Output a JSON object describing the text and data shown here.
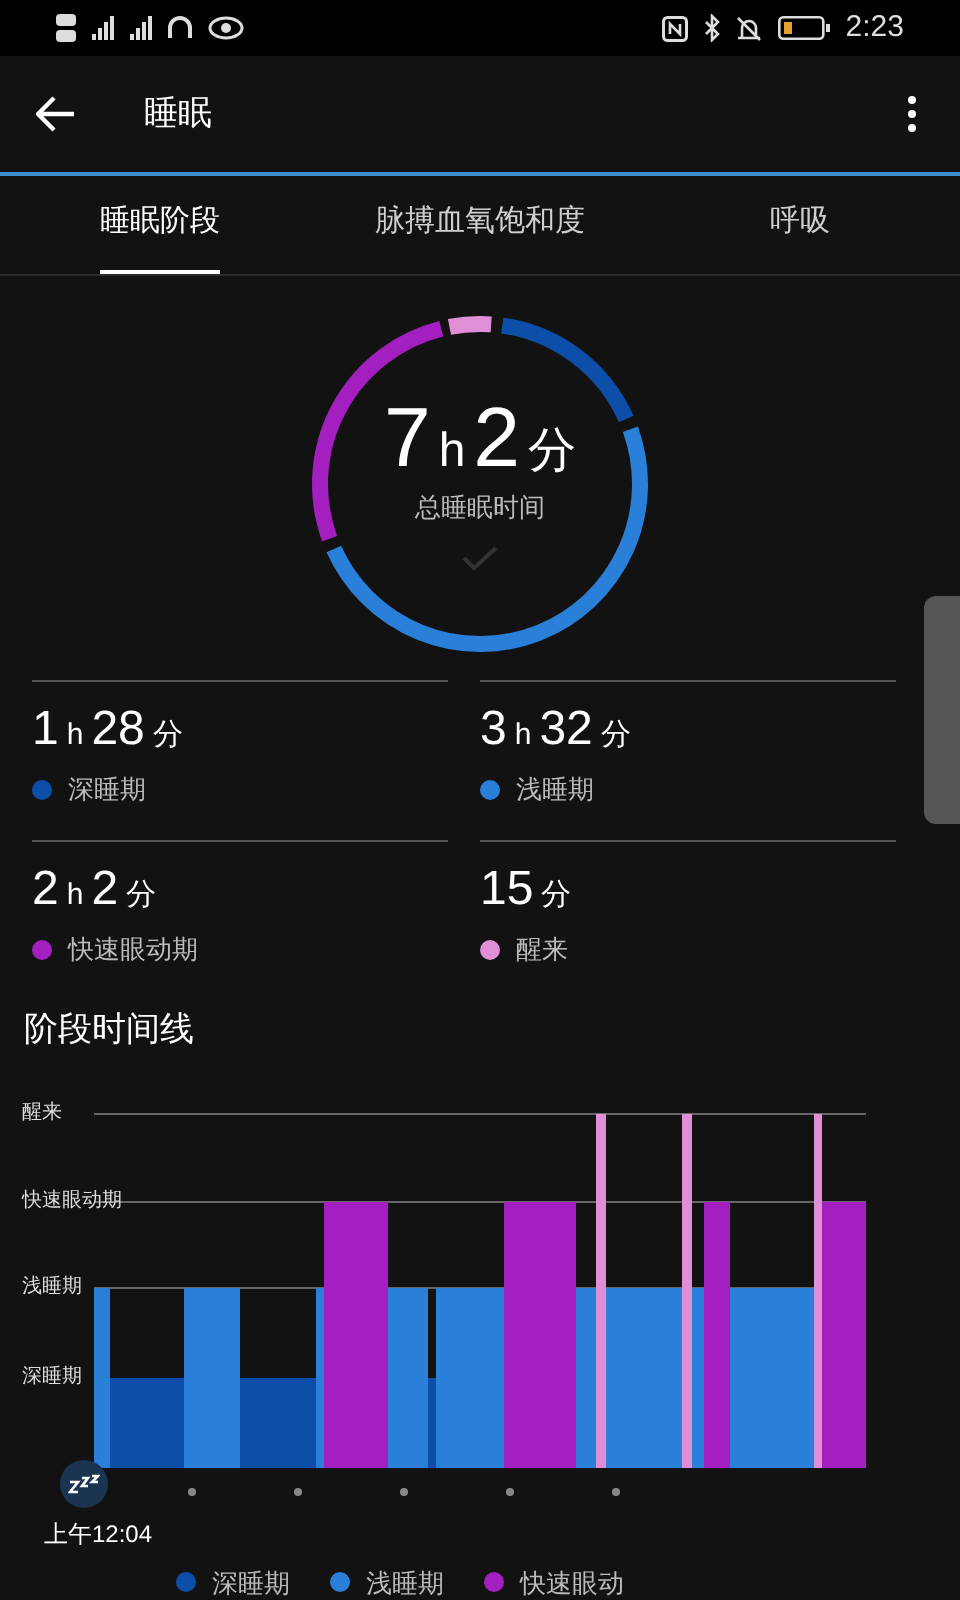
{
  "status_bar": {
    "time": "2:23"
  },
  "app_bar": {
    "title": "睡眠"
  },
  "tabs": [
    {
      "label": "睡眠阶段",
      "selected": true
    },
    {
      "label": "脉搏血氧饱和度",
      "selected": false
    },
    {
      "label": "呼吸",
      "selected": false
    }
  ],
  "summary": {
    "parts": [
      {
        "num": "7",
        "unit": "h"
      },
      {
        "num": "2",
        "unit": "分"
      }
    ],
    "caption": "总睡眠时间"
  },
  "stages": [
    {
      "parts": [
        {
          "num": "1",
          "unit": "h"
        },
        {
          "num": "28",
          "unit": "分"
        }
      ],
      "label": "深睡期",
      "color": "#0d4fa8"
    },
    {
      "parts": [
        {
          "num": "3",
          "unit": "h"
        },
        {
          "num": "32",
          "unit": "分"
        }
      ],
      "label": "浅睡期",
      "color": "#2a7fd8"
    },
    {
      "parts": [
        {
          "num": "2",
          "unit": "h"
        },
        {
          "num": "2",
          "unit": "分"
        }
      ],
      "label": "快速眼动期",
      "color": "#a31fc0"
    },
    {
      "parts": [
        {
          "num": "15",
          "unit": "分"
        }
      ],
      "label": "醒来",
      "color": "#e08fd6"
    }
  ],
  "timeline": {
    "title": "阶段时间线",
    "levels": [
      "醒来",
      "快速眼动期",
      "浅睡期",
      "深睡期"
    ],
    "start_time": "上午12:04",
    "legend": [
      {
        "label": "深睡期",
        "color": "#0d4fa8"
      },
      {
        "label": "浅睡期",
        "color": "#2a7fd8"
      },
      {
        "label": "快速眼动",
        "color": "#a31fc0"
      }
    ]
  }
}
